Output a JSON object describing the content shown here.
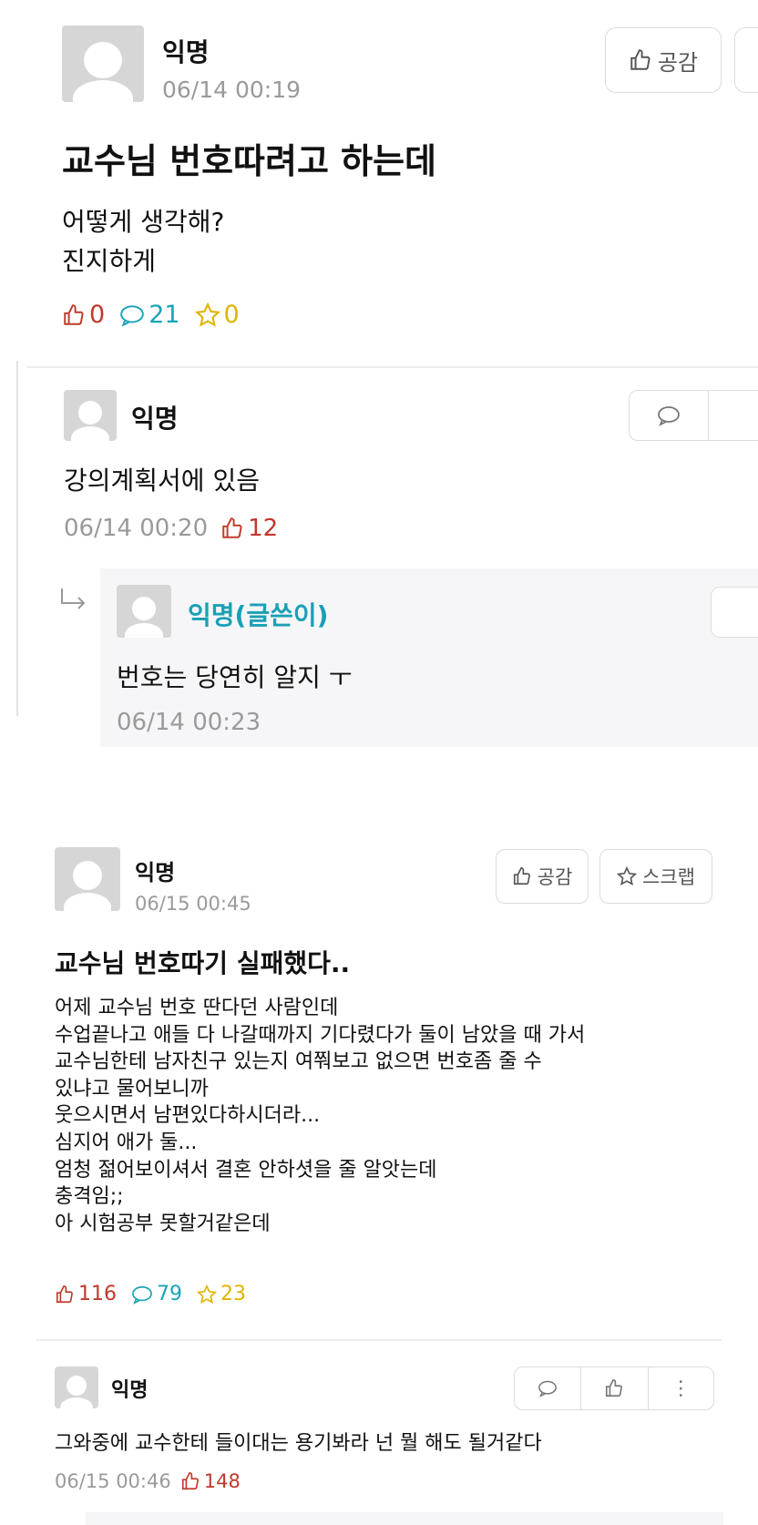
{
  "post1": {
    "author": "익명",
    "time": "06/14 00:19",
    "like_button": "공감",
    "title": "교수님 번호따려고 하는데",
    "body": "어떻게 생각해?\n진지하게",
    "likes": "0",
    "comments": "21",
    "scraps": "0",
    "comment": {
      "author": "익명",
      "text": "강의계획서에 있음",
      "time": "06/14 00:20",
      "likes": "12"
    },
    "reply": {
      "author": "익명(글쓴이)",
      "text": "번호는 당연히 알지 ㅜ",
      "time": "06/14 00:23"
    }
  },
  "post2": {
    "author": "익명",
    "time": "06/15 00:45",
    "like_button": "공감",
    "scrap_button": "스크랩",
    "title": "교수님 번호따기 실패했다..",
    "body": "어제 교수님 번호 딴다던 사람인데\n수업끝나고 애들 다 나갈때까지 기다렸다가 둘이 남았을 때 가서\n교수님한테 남자친구 있는지 여쭤보고 없으면 번호좀 줄 수\n있냐고 물어보니까\n웃으시면서 남편있다하시더라...\n심지어 애가 둘...\n엄청 젊어보이셔서 결혼 안하셧을 줄 알앗는데\n충격임;;\n아 시험공부 못할거같은데",
    "likes": "116",
    "comments": "79",
    "scraps": "23",
    "comment": {
      "author": "익명",
      "text": "그와중에 교수한테 들이대는 용기봐라 넌 뭘 해도 될거같다",
      "time": "06/15 00:46",
      "likes": "148",
      "more_label": "⋮"
    }
  },
  "colors": {
    "like": "#c0392b",
    "comment": "#19a3b8",
    "scrap": "#e0b400",
    "author_op": "#1aa0b5"
  },
  "icons": [
    "thumbs-up-icon",
    "speech-bubble-icon",
    "star-icon",
    "reply-arrow-icon",
    "more-vertical-icon",
    "avatar-icon"
  ]
}
